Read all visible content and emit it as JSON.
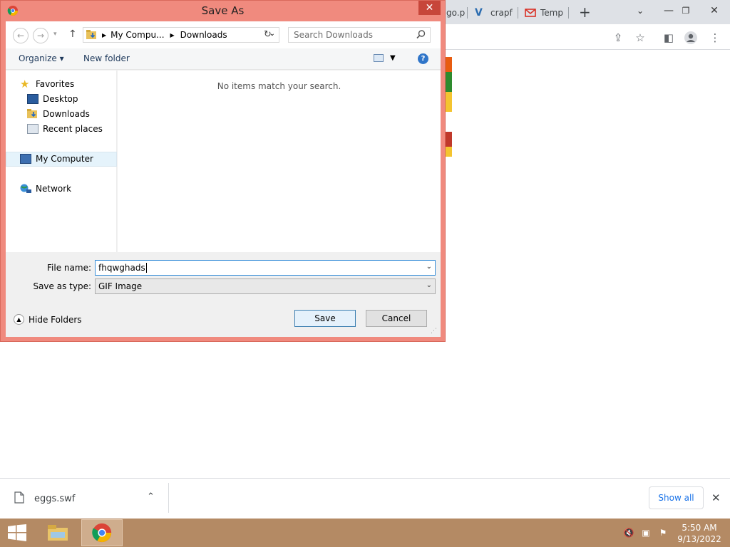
{
  "browser": {
    "tabs": [
      {
        "label": "go.p",
        "icon": "page-icon"
      },
      {
        "label": "crapf",
        "icon": "v-logo-icon"
      },
      {
        "label": "Temp",
        "icon": "mail-icon"
      }
    ],
    "new_tab": "+",
    "download_file": "eggs.swf",
    "show_all": "Show all"
  },
  "dialog": {
    "title": "Save As",
    "breadcrumb": [
      "My Compu...",
      "Downloads"
    ],
    "search_placeholder": "Search Downloads",
    "organize": "Organize ▾",
    "new_folder": "New folder",
    "nav": {
      "favorites": "Favorites",
      "desktop": "Desktop",
      "downloads": "Downloads",
      "recent": "Recent places",
      "computer": "My Computer",
      "network": "Network"
    },
    "empty_message": "No items match your search.",
    "file_name_label": "File name:",
    "file_name_value": "fhqwghads",
    "save_type_label": "Save as type:",
    "save_type_value": "GIF Image",
    "hide_folders": "Hide Folders",
    "save": "Save",
    "cancel": "Cancel"
  },
  "taskbar": {
    "time": "5:50 AM",
    "date": "9/13/2022"
  },
  "colors": {
    "dialog_frame": "#f08a7e",
    "close_button": "#c7463a",
    "taskbar": "#b48a64",
    "link_blue": "#1a73e8"
  }
}
